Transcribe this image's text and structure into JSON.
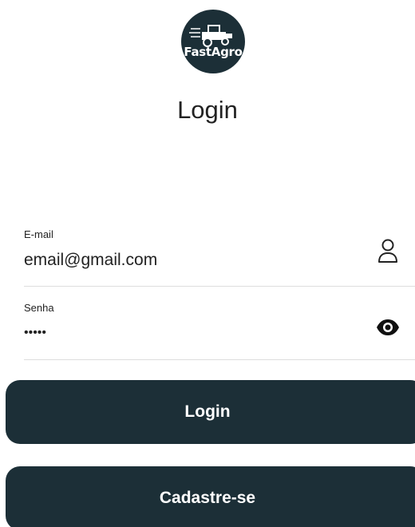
{
  "logo": {
    "text": "FastAgro",
    "icon": "tractor-icon"
  },
  "title": "Login",
  "email_field": {
    "label": "E-mail",
    "value": "email@gmail.com",
    "icon": "user-icon"
  },
  "password_field": {
    "label": "Senha",
    "value": "•••••",
    "icon": "eye-icon"
  },
  "buttons": {
    "login_label": "Login",
    "signup_label": "Cadastre-se"
  },
  "colors": {
    "primary": "#1c2f37",
    "button_text": "#ffffff",
    "divider": "#dddddd"
  }
}
